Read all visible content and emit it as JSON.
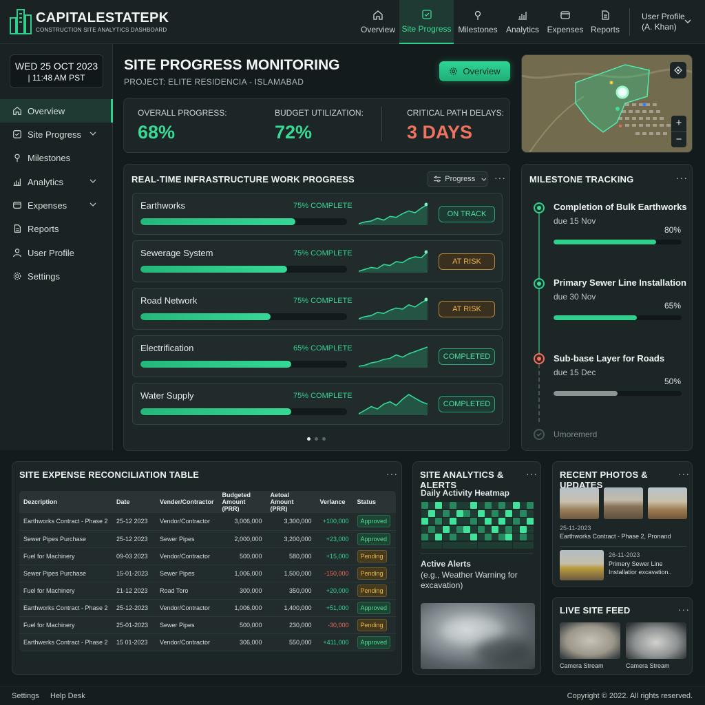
{
  "brand": {
    "name": "CAPITALESTATEPK",
    "subtitle": "CONSTRUCTION SITE ANALYTICS DASHBOARD"
  },
  "nav": {
    "items": [
      {
        "label": "Overview",
        "icon": "home-icon"
      },
      {
        "label": "Site Progress",
        "icon": "checkbox-icon",
        "active": true
      },
      {
        "label": "Milestones",
        "icon": "pin-icon"
      },
      {
        "label": "Analytics",
        "icon": "bar-chart-icon"
      },
      {
        "label": "Expenses",
        "icon": "wallet-icon"
      },
      {
        "label": "Reports",
        "icon": "document-icon"
      }
    ]
  },
  "user": {
    "line1": "User Profile",
    "line2": "(A. Khan)"
  },
  "datetime": {
    "date": "WED 25 OCT 2023",
    "time": "| 11:48 AM PST"
  },
  "sidebar": {
    "items": [
      {
        "label": "Overview",
        "icon": "home-icon",
        "active": true
      },
      {
        "label": "Site Progress",
        "icon": "checkbox-icon",
        "chevron": true
      },
      {
        "label": "Milestones",
        "icon": "pin-icon"
      },
      {
        "label": "Analytics",
        "icon": "bar-chart-icon",
        "chevron": true
      },
      {
        "label": "Expenses",
        "icon": "wallet-icon",
        "chevron": true
      },
      {
        "label": "Reports",
        "icon": "document-icon"
      },
      {
        "label": "User Profile",
        "icon": "user-icon"
      },
      {
        "label": "Settings",
        "icon": "gear-icon"
      }
    ]
  },
  "page": {
    "title": "SITE PROGRESS MONITORING",
    "project": "PROJECT: ELITE RESIDENCIA - ISLAMABAD",
    "overview_button": "Overview"
  },
  "kpis": {
    "progress_label": "OVERALL PROGRESS:",
    "progress_value": "68%",
    "budget_label": "BUDGET UTILIZATION:",
    "budget_value": "72%",
    "delay_label": "CRITICAL PATH DELAYS:",
    "delay_value": "3 DAYS"
  },
  "colors": {
    "accent": "#2fcf8c",
    "danger": "#f0735f",
    "warning": "#f0b64e"
  },
  "work": {
    "title": "REAL-TIME INFRASTRUCTURE WORK PROGRESS",
    "filter": "Progress",
    "rows": [
      {
        "name": "Earthworks",
        "pct_label": "75% COMPLETE",
        "fill": 0.75,
        "status": "ON TRACK",
        "tone": "green",
        "spark": [
          2,
          4,
          5,
          8,
          6,
          10,
          9,
          13,
          16,
          14,
          19,
          23
        ]
      },
      {
        "name": "Sewerage System",
        "pct_label": "75% COMPLETE",
        "fill": 0.71,
        "status": "AT RISK",
        "tone": "amber",
        "spark": [
          2,
          4,
          6,
          5,
          9,
          8,
          12,
          11,
          15,
          17,
          16,
          22
        ]
      },
      {
        "name": "Road Network",
        "pct_label": "75% COMPLETE",
        "fill": 0.63,
        "status": "AT RISK",
        "tone": "amber",
        "spark": [
          3,
          5,
          6,
          9,
          8,
          11,
          13,
          12,
          16,
          14,
          18,
          21
        ]
      },
      {
        "name": "Electrification",
        "pct_label": "65% COMPLETE",
        "fill": 0.73,
        "status": "COMPLETED",
        "tone": "green",
        "spark": [
          3,
          4,
          6,
          7,
          9,
          10,
          13,
          11,
          14,
          16,
          18,
          20
        ]
      },
      {
        "name": "Water Supply",
        "pct_label": "75% COMPLETE",
        "fill": 0.73,
        "status": "COMPLETED",
        "tone": "green",
        "spark": [
          2,
          5,
          8,
          6,
          10,
          12,
          9,
          14,
          18,
          15,
          12,
          10
        ]
      }
    ]
  },
  "milestones": {
    "title": "MILESTONE TRACKING",
    "items": [
      {
        "title": "Completion of Bulk Earthworks",
        "due": "due 15 Nov",
        "pct_label": "80%",
        "fill": 0.8,
        "tone": "green"
      },
      {
        "title": "Primary Sewer Line Installation",
        "due": "due 30 Nov",
        "pct_label": "65%",
        "fill": 0.65,
        "tone": "green"
      },
      {
        "title": "Sub-base Layer for Roads",
        "due": "due 15 Dec",
        "pct_label": "50%",
        "fill": 0.5,
        "tone": "orange"
      }
    ],
    "more": "Umoremerd"
  },
  "expense_table": {
    "title": "SITE EXPENSE RECONCILIATION TABLE",
    "headers": [
      "Dezcription",
      "Date",
      "Vender/Contractor",
      "Budgeted Amount (PRR)",
      "Aetoal Amount (PRR)",
      "Verlance",
      "Status"
    ],
    "rows": [
      [
        "Earthworks Contract - Phase 2",
        "25-12 2023",
        "Vendor/Contractor",
        "3,006,000",
        "3,300,000",
        "+100,000",
        "Approved"
      ],
      [
        "Sewer Pipes Purchase",
        "25-12 2023",
        "Sewer Pipes",
        "2,000,000",
        "3,200,000",
        "+23,000",
        "Approved"
      ],
      [
        "Fuel for Machinery",
        "09-03 2023",
        "Vendor/Contractor",
        "500,000",
        "580,000",
        "+15,000",
        "Pending"
      ],
      [
        "Sewer Pipes Purchase",
        "15-01-2023",
        "Sewer Pipes",
        "1,006,000",
        "1,500,000",
        "-150,000",
        "Pending"
      ],
      [
        "Fuel for Machinery",
        "21-12 2023",
        "Road Toro",
        "300,000",
        "350,000",
        "+20,000",
        "Pending"
      ],
      [
        "Earthworks Contract - Phase 2",
        "25-12-2023",
        "Vendor/Contractor",
        "1,006,000",
        "1,400,000",
        "+51,000",
        "Approved"
      ],
      [
        "Fuel for Machinery",
        "25-01-2023",
        "Sewer Pipes",
        "500,000",
        "230,000",
        "-30,000",
        "Pending"
      ],
      [
        "Earthwerks Contract - Phase 2",
        "15 01-2023",
        "Vendor/Contractor",
        "306,000",
        "550,000",
        "+411,000",
        "Approved"
      ]
    ]
  },
  "analytics": {
    "title": "SITE ANALYTICS & ALERTS",
    "heatmap_label": "Daily Activity Heatmap",
    "heatmap": [
      [
        2,
        1,
        3,
        1,
        2,
        1,
        1,
        3,
        1,
        2,
        1,
        2,
        1,
        3,
        1,
        2
      ],
      [
        1,
        3,
        1,
        2,
        1,
        3,
        2,
        1,
        3,
        1,
        2,
        1,
        3,
        1,
        2,
        1
      ],
      [
        3,
        1,
        2,
        1,
        3,
        1,
        1,
        2,
        1,
        3,
        1,
        3,
        1,
        2,
        1,
        3
      ],
      [
        1,
        2,
        1,
        3,
        1,
        2,
        3,
        1,
        2,
        1,
        3,
        1,
        2,
        1,
        3,
        1
      ],
      [
        2,
        1,
        3,
        1,
        2,
        1,
        1,
        3,
        1,
        2,
        1,
        2,
        3,
        1,
        2,
        1
      ],
      [
        1,
        1,
        1,
        1,
        1,
        1,
        1,
        1,
        1,
        1,
        1,
        1,
        1,
        1,
        1,
        1
      ]
    ],
    "alerts_label": "Active Alerts",
    "alert_text": "(e.g., Weather Warning for excavation)"
  },
  "photos": {
    "title": "RECENT PHOTOS & UPDATES",
    "item1_date": "25-11-2023",
    "item1_caption": "Earthworks Contract - Phase 2, Pronand",
    "item2_date": "26-11-2023",
    "item2_line1": "Primery Sewer Line",
    "item2_line2": "Installatior excavation.."
  },
  "live_feed": {
    "title": "LIVE SITE FEED",
    "cam1": "Camera Stream",
    "cam2": "Camera Stream"
  },
  "footer": {
    "settings": "Settings",
    "help": "Help Desk",
    "copyright": "Copyright © 2022. All rights reserved."
  }
}
